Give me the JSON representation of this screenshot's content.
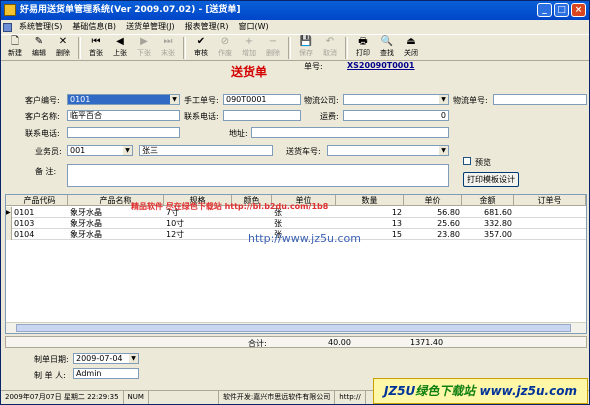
{
  "window": {
    "title": "好易用送货单管理系统(Ver 2009.07.02) - [送货单]",
    "min": "_",
    "max": "□",
    "close": "×"
  },
  "menu": [
    "系统管理(S)",
    "基础信息(B)",
    "送货单管理(J)",
    "报表管理(R)",
    "窗口(W)"
  ],
  "toolbar": [
    {
      "label": "新建",
      "icon": "new-icon",
      "glyph": "🗋",
      "enabled": true
    },
    {
      "label": "编辑",
      "icon": "edit-icon",
      "glyph": "✎",
      "enabled": true
    },
    {
      "label": "删除",
      "icon": "delete-icon",
      "glyph": "✕",
      "enabled": true
    },
    {
      "label": "首张",
      "icon": "first-icon",
      "glyph": "⏮",
      "enabled": true
    },
    {
      "label": "上张",
      "icon": "prev-icon",
      "glyph": "◀",
      "enabled": true
    },
    {
      "label": "下张",
      "icon": "next-icon",
      "glyph": "▶",
      "enabled": false
    },
    {
      "label": "末张",
      "icon": "last-icon",
      "glyph": "⏭",
      "enabled": false
    },
    {
      "label": "审核",
      "icon": "approve-icon",
      "glyph": "✔",
      "enabled": true
    },
    {
      "label": "作废",
      "icon": "void-icon",
      "glyph": "⊘",
      "enabled": false
    },
    {
      "label": "增加",
      "icon": "add-row-icon",
      "glyph": "+",
      "enabled": false
    },
    {
      "label": "删除",
      "icon": "remove-row-icon",
      "glyph": "−",
      "enabled": false
    },
    {
      "label": "保存",
      "icon": "save-icon",
      "glyph": "💾",
      "enabled": false
    },
    {
      "label": "取消",
      "icon": "undo-icon",
      "glyph": "↶",
      "enabled": false
    },
    {
      "label": "打印",
      "icon": "print-icon",
      "glyph": "🖶",
      "enabled": true
    },
    {
      "label": "查找",
      "icon": "find-icon",
      "glyph": "🔍",
      "enabled": true
    },
    {
      "label": "关闭",
      "icon": "close-icon",
      "glyph": "⏏",
      "enabled": true
    }
  ],
  "form": {
    "title": "送货单",
    "doc_no_label": "单号:",
    "doc_no": "XS20090T0001",
    "customer_code_label": "客户编号:",
    "customer_code": "0101",
    "manual_no_label": "手工单号:",
    "manual_no": "090T0001",
    "logistics_company_label": "物流公司:",
    "logistics_company": "",
    "logistics_no_label": "物流单号:",
    "logistics_no": "",
    "customer_name_label": "客户名称:",
    "customer_name": "临平百合",
    "contact_phone_label": "联系电话:",
    "contact_phone": "",
    "freight_label": "运费:",
    "freight": "0",
    "contact_phone2_label": "联系电话:",
    "contact_phone2": "",
    "address_label": "地址:",
    "address": "",
    "salesman_label": "业务员:",
    "salesman_code": "001",
    "salesman_name": "张三",
    "vehicle_label": "送货车号:",
    "vehicle": "",
    "remark_label": "备    注:",
    "remark": "",
    "preview_label": "预览",
    "print_template_button": "打印模板设计"
  },
  "grid": {
    "columns": [
      "产品代码",
      "产品名称",
      "规格",
      "颜色",
      "单位",
      "数量",
      "单价",
      "金额",
      "订单号"
    ],
    "rows": [
      {
        "code": "0101",
        "name": "象牙水晶",
        "spec": "7寸",
        "color": "",
        "unit": "张",
        "qty": "12",
        "price": "56.80",
        "amount": "681.60",
        "order": ""
      },
      {
        "code": "0103",
        "name": "象牙水晶",
        "spec": "10寸",
        "color": "",
        "unit": "张",
        "qty": "13",
        "price": "25.60",
        "amount": "332.80",
        "order": ""
      },
      {
        "code": "0104",
        "name": "象牙水晶",
        "spec": "12寸",
        "color": "",
        "unit": "张",
        "qty": "15",
        "price": "23.80",
        "amount": "357.00",
        "order": ""
      }
    ],
    "total_label": "合计:",
    "total_qty": "40.00",
    "total_amount": "1371.40"
  },
  "footer": {
    "date_label": "制单日期:",
    "date": "2009-07-04",
    "maker_label": "制 单 人:",
    "maker": "Admin"
  },
  "statusbar": {
    "datetime": "2009年07月07日 星期二 22:29:35",
    "num": "NUM",
    "dev": "软件开发:嘉兴市思远软件有限公司",
    "url": "http://"
  },
  "watermarks": {
    "url": "http://www.jz5u.com",
    "red": "精品软件 尽在绿色下载站 http://bl.b2du.com/1b8",
    "promo_a": "JZ5U",
    "promo_b": "绿色下载站",
    "promo_c": "www.jz5u.com"
  },
  "colors": {
    "title_bar": "#0046c8",
    "doc_title": "#d40000",
    "selection": "#316ac5"
  }
}
